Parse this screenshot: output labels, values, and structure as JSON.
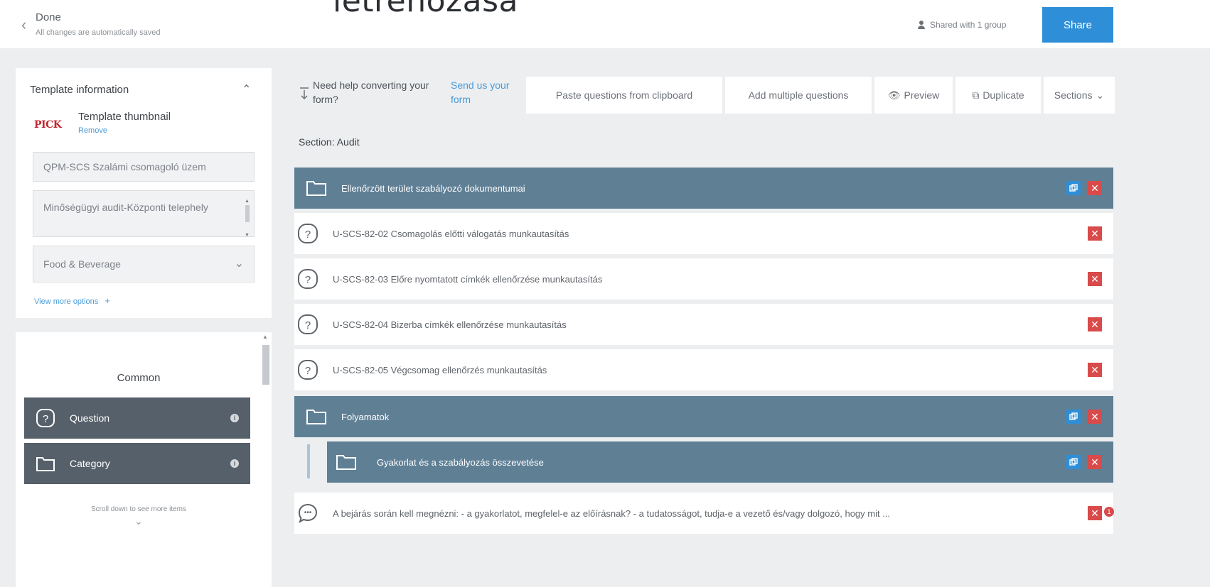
{
  "header": {
    "done_label": "Done",
    "saved_status": "All changes are automatically saved",
    "page_heading": "létrehozása",
    "shared_status": "Shared with 1 group",
    "share_label": "Share"
  },
  "template_info": {
    "heading": "Template information",
    "thumbnail_logo": "PICK",
    "thumbnail_label": "Template thumbnail",
    "remove_label": "Remove",
    "name_value": "QPM-SCS Szalámi csomagoló üzem",
    "description_value": "Minőségügyi audit-Központi telephely",
    "industry_value": "Food & Beverage",
    "more_options_label": "View more options"
  },
  "items_panel": {
    "heading": "Common",
    "items": [
      {
        "label": "Question",
        "icon": "question-icon"
      },
      {
        "label": "Category",
        "icon": "folder-icon"
      }
    ],
    "scroll_hint": "Scroll down to see more items"
  },
  "toolbar": {
    "help_text": "Need help converting your form?",
    "send_link": "Send us your form",
    "paste_label": "Paste questions from clipboard",
    "add_multiple_label": "Add multiple questions",
    "preview_label": "Preview",
    "duplicate_label": "Duplicate",
    "sections_label": "Sections"
  },
  "section": {
    "label": "Section: Audit",
    "rows": [
      {
        "type": "category",
        "text": "Ellenőrzött terület szabályozó dokumentumai"
      },
      {
        "type": "question",
        "text": "U-SCS-82-02 Csomagolás előtti válogatás munkautasítás"
      },
      {
        "type": "question",
        "text": "U-SCS-82-03 Előre nyomtatott címkék ellenőrzése munkautasítás"
      },
      {
        "type": "question",
        "text": "U-SCS-82-04 Bizerba címkék ellenőrzése munkautasítás"
      },
      {
        "type": "question",
        "text": "U-SCS-82-05 Végcsomag ellenőrzés munkautasítás"
      },
      {
        "type": "category",
        "text": "Folyamatok"
      },
      {
        "type": "subcategory",
        "text": "Gyakorlat és a szabályozás összevetése"
      },
      {
        "type": "comment",
        "text": "A bejárás során kell megnézni: - a gyakorlatot, megfelel-e az előírásnak? - a tudatosságot, tudja-e a vezető és/vagy dolgozó, hogy mit ..."
      }
    ],
    "notification_count": "1"
  }
}
